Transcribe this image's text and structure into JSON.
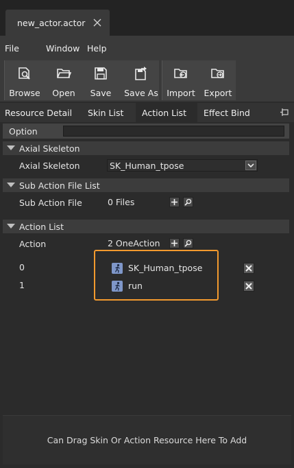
{
  "document_tab": {
    "title": "new_actor.actor"
  },
  "menu": {
    "items": [
      "File",
      "Window",
      "Help"
    ]
  },
  "toolbar": {
    "browse": "Browse",
    "open": "Open",
    "save": "Save",
    "save_as": "Save As",
    "import": "Import",
    "export": "Export"
  },
  "tabs": {
    "items": [
      "Resource Detail",
      "Skin List",
      "Action List",
      "Effect Bind"
    ],
    "active": "Action List"
  },
  "option": {
    "label": "Option",
    "value": ""
  },
  "axial_skeleton": {
    "section_title": "Axial Skeleton",
    "label": "Axial Skeleton",
    "value": "SK_Human_tpose"
  },
  "sub_action_files": {
    "section_title": "Sub Action File List",
    "label": "Sub Action File",
    "count": "0 Files"
  },
  "action_list": {
    "section_title": "Action List",
    "label": "Action",
    "count": "2 OneAction",
    "items": [
      {
        "index": "0",
        "name": "SK_Human_tpose"
      },
      {
        "index": "1",
        "name": "run"
      }
    ]
  },
  "drop_hint": "Can Drag Skin Or Action Resource Here To Add",
  "colors": {
    "highlight": "#f39a2e",
    "background": "#2b2b2b",
    "icon_blue": "#7f97c9"
  },
  "icons": [
    "close-icon",
    "browse-icon",
    "open-folder-icon",
    "save-icon",
    "save-as-icon",
    "import-icon",
    "export-icon",
    "pin-icon",
    "expand-triangle-icon",
    "dropdown-arrow-icon",
    "plus-icon",
    "search-icon",
    "action-run-icon",
    "remove-x-icon"
  ]
}
